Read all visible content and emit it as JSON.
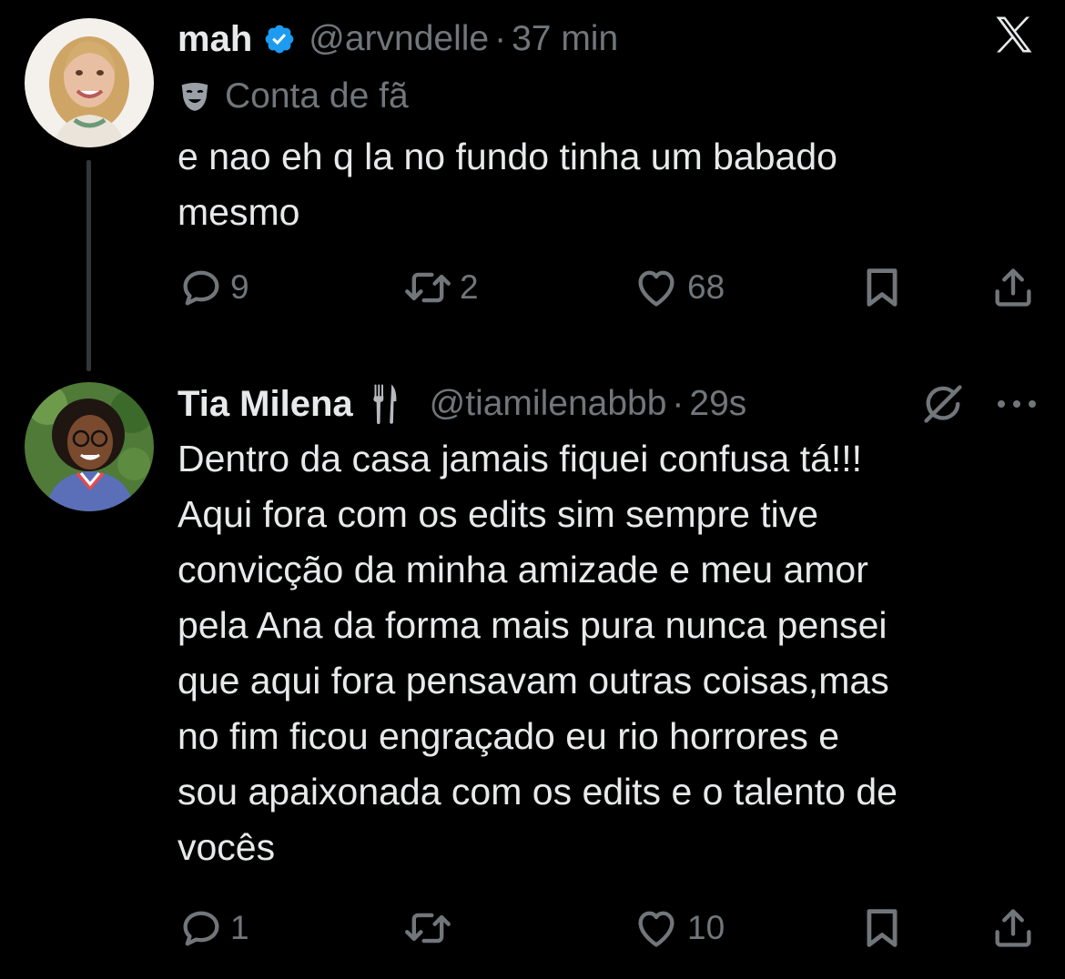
{
  "tweets": [
    {
      "display_name": "mah",
      "verified": true,
      "handle": "@arvndelle",
      "separator": "·",
      "time": "37 min",
      "label_icon": "theater-mask-icon",
      "label": "Conta de fã",
      "text_lines": [
        "e nao eh q la no fundo tinha um babado",
        "mesmo"
      ],
      "replies": "9",
      "reposts": "2",
      "likes": "68",
      "top_right_icon": "x-logo-icon"
    },
    {
      "display_name": "Tia Milena",
      "name_emoji_icon": "fork-and-knife-icon",
      "handle": "@tiamilenabbb",
      "separator": "·",
      "time": "29s",
      "text_lines": [
        "Dentro da casa jamais fiquei confusa tá!!!",
        "Aqui fora com os edits sim sempre tive",
        "convicção da minha amizade e meu amor",
        "pela Ana da forma mais pura nunca pensei",
        "que aqui fora pensavam outras coisas,mas",
        "no fim ficou engraçado eu rio horrores e",
        "sou apaixonada com os edits e o talento de",
        "vocês"
      ],
      "replies": "1",
      "reposts": "",
      "likes": "10",
      "top_right_icons": [
        "grok-icon",
        "more-options-icon"
      ]
    }
  ],
  "colors": {
    "background": "#000000",
    "primary_text": "#e7e9ea",
    "secondary_text": "#71767b",
    "verified_blue": "#1d9bf0",
    "thread_line": "#333639"
  }
}
